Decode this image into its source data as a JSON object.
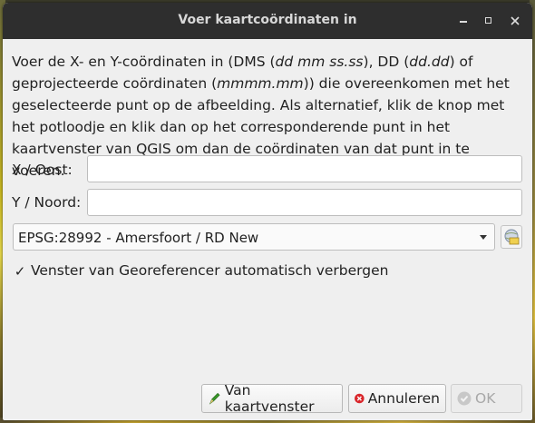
{
  "window": {
    "title": "Voer kaartcoördinaten in",
    "min_icon": "minimize-icon",
    "max_icon": "maximize-icon",
    "close_icon": "close-icon"
  },
  "description": {
    "part1": "Voer de X- en Y-coördinaten in (DMS (",
    "dms_format": "dd mm ss.ss",
    "part2": "), DD (",
    "dd_format": "dd.dd",
    "part3": ") of geprojecteerde coördinaten (",
    "proj_format": "mmmm.mm",
    "part4": ")) die overeenkomen met het geselecteerde punt op de afbeelding. Als alternatief, klik de knop met het potloodje en klik dan op het corresponderende punt in het kaartvenster van QGIS om dan de coördinaten van dat punt in te voeren."
  },
  "form": {
    "x_label": "X / Oost:",
    "x_value": "",
    "y_label": "Y / Noord:",
    "y_value": "",
    "crs_selected": "EPSG:28992 - Amersfoort / RD New",
    "crs_button_icon": "crs-selector-icon"
  },
  "checkbox": {
    "checked": true,
    "mark": "✓",
    "label": "Venster van Georeferencer automatisch verbergen"
  },
  "buttons": {
    "from_canvas": "Van kaartvenster",
    "cancel": "Annuleren",
    "ok": "OK"
  },
  "colors": {
    "titlebar": "#2e2e2e",
    "dialog_bg": "#efefef",
    "pencil_green": "#3a9a2a",
    "cancel_red": "#d9262b"
  }
}
